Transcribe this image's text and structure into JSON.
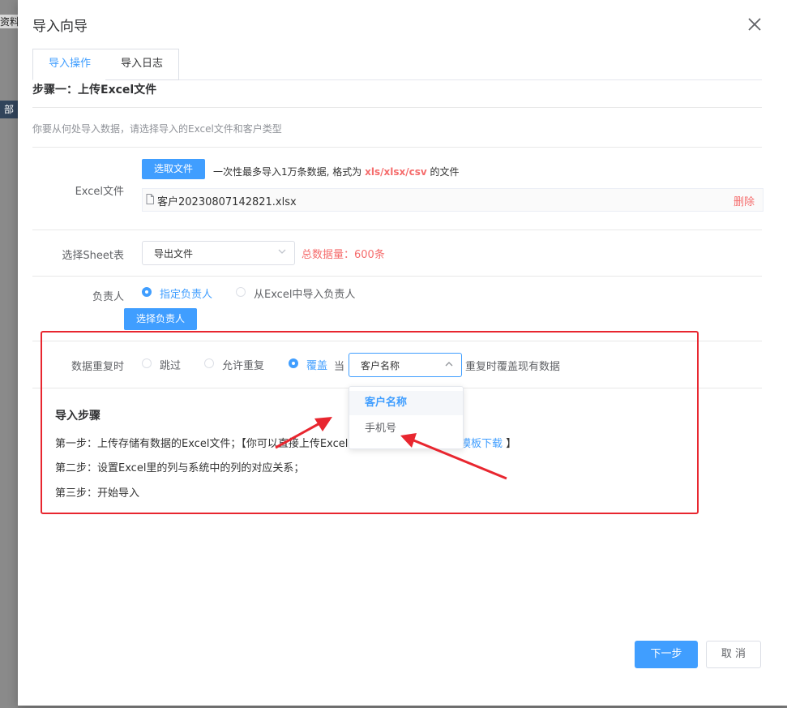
{
  "background": {
    "fragment_top": "资料板",
    "fragment_left": "部"
  },
  "dialog": {
    "title": "导入向导",
    "close_icon": "close-icon"
  },
  "tabs": [
    {
      "label": "导入操作",
      "active": true
    },
    {
      "label": "导入日志",
      "active": false
    }
  ],
  "step_one": {
    "title": "步骤一：上传Excel文件",
    "description": "你要从何处导入数据，请选择导入的Excel文件和客户类型"
  },
  "excel_file": {
    "label": "Excel文件",
    "choose_button": "选取文件",
    "hint_prefix": "一次性最多导入1万条数据, 格式为",
    "hint_formats": "xls/xlsx/csv",
    "hint_suffix": "的文件",
    "file_name": "客户20230807142821.xlsx",
    "delete_label": "删除"
  },
  "sheet": {
    "label": "选择Sheet表",
    "selected": "导出文件",
    "total": "总数据量：600条"
  },
  "owner": {
    "label": "负责人",
    "options": [
      "指定负责人",
      "从Excel中导入负责人"
    ],
    "selected_index": 0,
    "select_button": "选择负责人"
  },
  "duplicate": {
    "label": "数据重复时",
    "options": [
      "跳过",
      "允许重复",
      "覆盖"
    ],
    "selected_index": 2,
    "when_text": "当",
    "field_selected": "客户名称",
    "suffix_text": "重复时覆盖现有数据",
    "dropdown_options": [
      "客户名称",
      "手机号"
    ]
  },
  "import_steps": {
    "title": "导入步骤",
    "step1_text": "第一步：上传存储有数据的Excel文件；【你可以直接上传Excel",
    "step1_link": "模板下载",
    "step1_end": "】",
    "step2_text": "第二步：设置Excel里的列与系统中的列的对应关系；",
    "step3_text": "第三步：开始导入"
  },
  "footer": {
    "next_label": "下一步",
    "cancel_label": "取 消"
  },
  "colors": {
    "primary": "#409eff",
    "danger": "#f56c6c",
    "annotation": "#e8262f"
  }
}
